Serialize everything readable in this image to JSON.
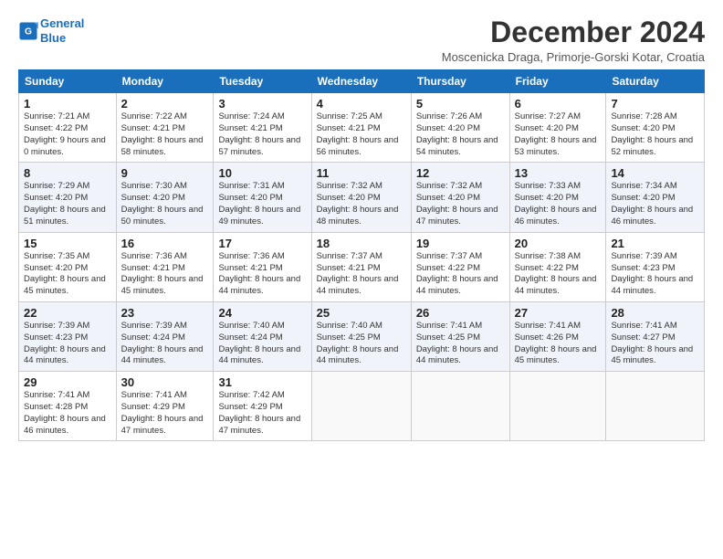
{
  "logo": {
    "line1": "General",
    "line2": "Blue"
  },
  "title": "December 2024",
  "subtitle": "Moscenicka Draga, Primorje-Gorski Kotar, Croatia",
  "days_of_week": [
    "Sunday",
    "Monday",
    "Tuesday",
    "Wednesday",
    "Thursday",
    "Friday",
    "Saturday"
  ],
  "weeks": [
    [
      {
        "day": "1",
        "sunrise": "7:21 AM",
        "sunset": "4:22 PM",
        "daylight": "9 hours and 0 minutes"
      },
      {
        "day": "2",
        "sunrise": "7:22 AM",
        "sunset": "4:21 PM",
        "daylight": "8 hours and 58 minutes"
      },
      {
        "day": "3",
        "sunrise": "7:24 AM",
        "sunset": "4:21 PM",
        "daylight": "8 hours and 57 minutes"
      },
      {
        "day": "4",
        "sunrise": "7:25 AM",
        "sunset": "4:21 PM",
        "daylight": "8 hours and 56 minutes"
      },
      {
        "day": "5",
        "sunrise": "7:26 AM",
        "sunset": "4:20 PM",
        "daylight": "8 hours and 54 minutes"
      },
      {
        "day": "6",
        "sunrise": "7:27 AM",
        "sunset": "4:20 PM",
        "daylight": "8 hours and 53 minutes"
      },
      {
        "day": "7",
        "sunrise": "7:28 AM",
        "sunset": "4:20 PM",
        "daylight": "8 hours and 52 minutes"
      }
    ],
    [
      {
        "day": "8",
        "sunrise": "7:29 AM",
        "sunset": "4:20 PM",
        "daylight": "8 hours and 51 minutes"
      },
      {
        "day": "9",
        "sunrise": "7:30 AM",
        "sunset": "4:20 PM",
        "daylight": "8 hours and 50 minutes"
      },
      {
        "day": "10",
        "sunrise": "7:31 AM",
        "sunset": "4:20 PM",
        "daylight": "8 hours and 49 minutes"
      },
      {
        "day": "11",
        "sunrise": "7:32 AM",
        "sunset": "4:20 PM",
        "daylight": "8 hours and 48 minutes"
      },
      {
        "day": "12",
        "sunrise": "7:32 AM",
        "sunset": "4:20 PM",
        "daylight": "8 hours and 47 minutes"
      },
      {
        "day": "13",
        "sunrise": "7:33 AM",
        "sunset": "4:20 PM",
        "daylight": "8 hours and 46 minutes"
      },
      {
        "day": "14",
        "sunrise": "7:34 AM",
        "sunset": "4:20 PM",
        "daylight": "8 hours and 46 minutes"
      }
    ],
    [
      {
        "day": "15",
        "sunrise": "7:35 AM",
        "sunset": "4:20 PM",
        "daylight": "8 hours and 45 minutes"
      },
      {
        "day": "16",
        "sunrise": "7:36 AM",
        "sunset": "4:21 PM",
        "daylight": "8 hours and 45 minutes"
      },
      {
        "day": "17",
        "sunrise": "7:36 AM",
        "sunset": "4:21 PM",
        "daylight": "8 hours and 44 minutes"
      },
      {
        "day": "18",
        "sunrise": "7:37 AM",
        "sunset": "4:21 PM",
        "daylight": "8 hours and 44 minutes"
      },
      {
        "day": "19",
        "sunrise": "7:37 AM",
        "sunset": "4:22 PM",
        "daylight": "8 hours and 44 minutes"
      },
      {
        "day": "20",
        "sunrise": "7:38 AM",
        "sunset": "4:22 PM",
        "daylight": "8 hours and 44 minutes"
      },
      {
        "day": "21",
        "sunrise": "7:39 AM",
        "sunset": "4:23 PM",
        "daylight": "8 hours and 44 minutes"
      }
    ],
    [
      {
        "day": "22",
        "sunrise": "7:39 AM",
        "sunset": "4:23 PM",
        "daylight": "8 hours and 44 minutes"
      },
      {
        "day": "23",
        "sunrise": "7:39 AM",
        "sunset": "4:24 PM",
        "daylight": "8 hours and 44 minutes"
      },
      {
        "day": "24",
        "sunrise": "7:40 AM",
        "sunset": "4:24 PM",
        "daylight": "8 hours and 44 minutes"
      },
      {
        "day": "25",
        "sunrise": "7:40 AM",
        "sunset": "4:25 PM",
        "daylight": "8 hours and 44 minutes"
      },
      {
        "day": "26",
        "sunrise": "7:41 AM",
        "sunset": "4:25 PM",
        "daylight": "8 hours and 44 minutes"
      },
      {
        "day": "27",
        "sunrise": "7:41 AM",
        "sunset": "4:26 PM",
        "daylight": "8 hours and 45 minutes"
      },
      {
        "day": "28",
        "sunrise": "7:41 AM",
        "sunset": "4:27 PM",
        "daylight": "8 hours and 45 minutes"
      }
    ],
    [
      {
        "day": "29",
        "sunrise": "7:41 AM",
        "sunset": "4:28 PM",
        "daylight": "8 hours and 46 minutes"
      },
      {
        "day": "30",
        "sunrise": "7:41 AM",
        "sunset": "4:29 PM",
        "daylight": "8 hours and 47 minutes"
      },
      {
        "day": "31",
        "sunrise": "7:42 AM",
        "sunset": "4:29 PM",
        "daylight": "8 hours and 47 minutes"
      },
      null,
      null,
      null,
      null
    ]
  ]
}
